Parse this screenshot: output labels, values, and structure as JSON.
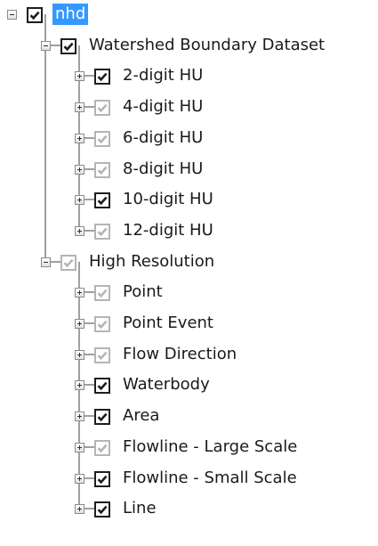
{
  "root": {
    "label": "nhd",
    "checked": true,
    "dim": false,
    "expanded": true,
    "selected": true,
    "icon": "tree-collapse-icon",
    "children": [
      {
        "label": "Watershed Boundary Dataset",
        "checked": true,
        "dim": false,
        "expanded": true,
        "children": [
          {
            "label": "2-digit HU",
            "checked": true,
            "dim": false
          },
          {
            "label": "4-digit HU",
            "checked": true,
            "dim": true
          },
          {
            "label": "6-digit HU",
            "checked": true,
            "dim": true
          },
          {
            "label": "8-digit HU",
            "checked": true,
            "dim": true
          },
          {
            "label": "10-digit HU",
            "checked": true,
            "dim": false
          },
          {
            "label": "12-digit HU",
            "checked": true,
            "dim": true
          }
        ]
      },
      {
        "label": "High Resolution",
        "checked": true,
        "dim": true,
        "expanded": true,
        "children": [
          {
            "label": "Point",
            "checked": true,
            "dim": true
          },
          {
            "label": "Point Event",
            "checked": true,
            "dim": true
          },
          {
            "label": "Flow Direction",
            "checked": true,
            "dim": true
          },
          {
            "label": "Waterbody",
            "checked": true,
            "dim": false
          },
          {
            "label": "Area",
            "checked": true,
            "dim": false
          },
          {
            "label": "Flowline - Large Scale",
            "checked": true,
            "dim": true
          },
          {
            "label": "Flowline - Small Scale",
            "checked": true,
            "dim": false
          },
          {
            "label": "Line",
            "checked": true,
            "dim": false
          }
        ]
      }
    ]
  },
  "colors": {
    "selection": "#3399ff",
    "tree_line": "#a0a0a0",
    "checkbox_enabled": "#1e1e1e",
    "checkbox_dimmed": "#b5b5b5"
  },
  "icons": {
    "expand": "tree-expand-icon",
    "collapse": "tree-collapse-icon",
    "check": "checkmark-icon"
  }
}
